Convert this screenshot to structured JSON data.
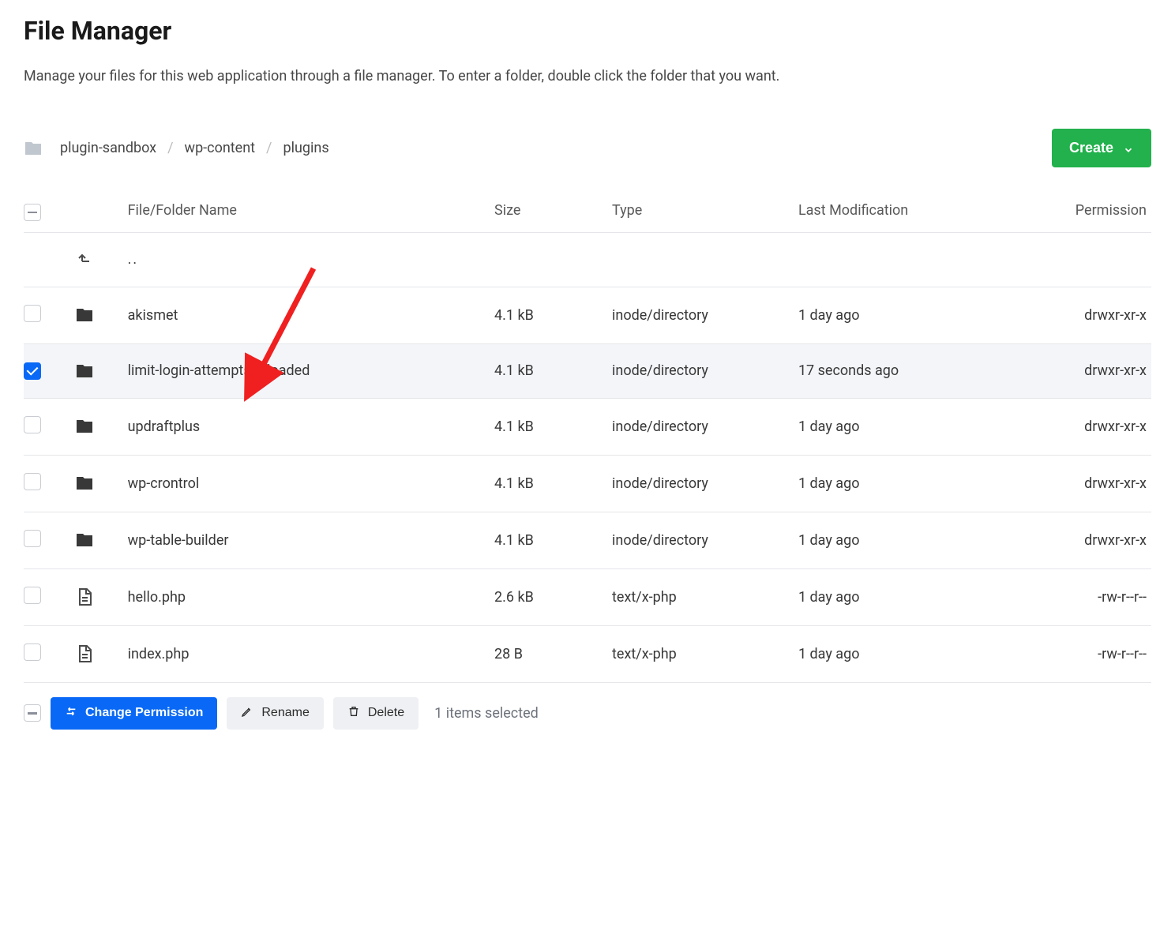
{
  "title": "File Manager",
  "subtitle": "Manage your files for this web application through a file manager. To enter a folder, double click the folder that you want.",
  "breadcrumb": [
    "plugin-sandbox",
    "wp-content",
    "plugins"
  ],
  "create_label": "Create",
  "columns": {
    "name": "File/Folder Name",
    "size": "Size",
    "type": "Type",
    "modified": "Last Modification",
    "permission": "Permission"
  },
  "up_label": "..",
  "rows": [
    {
      "icon": "folder",
      "name": "akismet",
      "size": "4.1 kB",
      "type": "inode/directory",
      "modified": "1 day ago",
      "permission": "drwxr-xr-x",
      "selected": false
    },
    {
      "icon": "folder",
      "name": "limit-login-attempts-reloaded",
      "size": "4.1 kB",
      "type": "inode/directory",
      "modified": "17 seconds ago",
      "permission": "drwxr-xr-x",
      "selected": true
    },
    {
      "icon": "folder",
      "name": "updraftplus",
      "size": "4.1 kB",
      "type": "inode/directory",
      "modified": "1 day ago",
      "permission": "drwxr-xr-x",
      "selected": false
    },
    {
      "icon": "folder",
      "name": "wp-crontrol",
      "size": "4.1 kB",
      "type": "inode/directory",
      "modified": "1 day ago",
      "permission": "drwxr-xr-x",
      "selected": false
    },
    {
      "icon": "folder",
      "name": "wp-table-builder",
      "size": "4.1 kB",
      "type": "inode/directory",
      "modified": "1 day ago",
      "permission": "drwxr-xr-x",
      "selected": false
    },
    {
      "icon": "file",
      "name": "hello.php",
      "size": "2.6 kB",
      "type": "text/x-php",
      "modified": "1 day ago",
      "permission": "-rw-r--r--",
      "selected": false
    },
    {
      "icon": "file",
      "name": "index.php",
      "size": "28 B",
      "type": "text/x-php",
      "modified": "1 day ago",
      "permission": "-rw-r--r--",
      "selected": false
    }
  ],
  "actions": {
    "change_permission": "Change Permission",
    "rename": "Rename",
    "delete": "Delete"
  },
  "selection_status": "1 items selected"
}
